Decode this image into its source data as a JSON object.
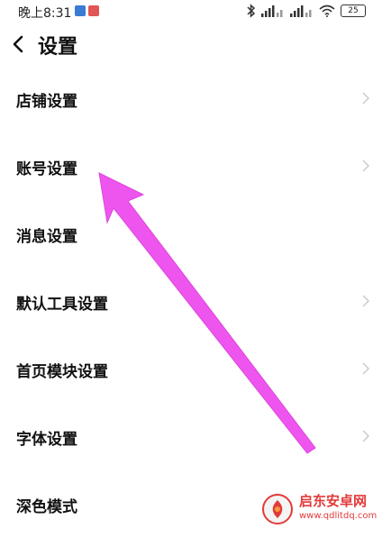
{
  "status_bar": {
    "time": "晚上8:31",
    "battery": "25"
  },
  "header": {
    "title": "设置"
  },
  "settings": {
    "items": [
      {
        "label": "店铺设置",
        "has_chevron": true
      },
      {
        "label": "账号设置",
        "has_chevron": true
      },
      {
        "label": "消息设置",
        "has_chevron": false
      },
      {
        "label": "默认工具设置",
        "has_chevron": true
      },
      {
        "label": "首页模块设置",
        "has_chevron": true
      },
      {
        "label": "字体设置",
        "has_chevron": true
      },
      {
        "label": "深色模式",
        "has_chevron": false
      }
    ]
  },
  "annotation": {
    "color": "#ee55ee"
  },
  "watermark": {
    "name": "启东安卓网",
    "url": "www.qdlitdq.com",
    "color": "#e33a3a"
  }
}
